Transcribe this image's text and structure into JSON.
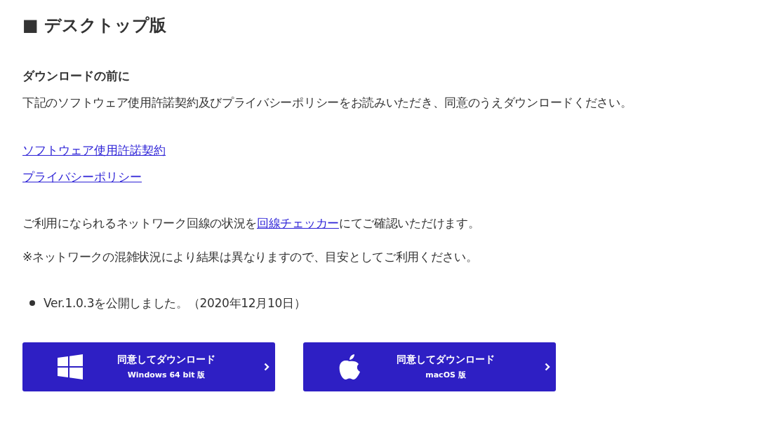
{
  "heading": "■ デスクトップ版",
  "subheading": "ダウンロードの前に",
  "intro": "下記のソフトウェア使用許諾契約及びプライバシーポリシーをお読みいただき、同意のうえダウンロードください。",
  "links": [
    "ソフトウェア使用許諾契約",
    "プライバシーポリシー"
  ],
  "network_note": {
    "before": "ご利用になられるネットワーク回線の状況を",
    "link": "回線チェッカー",
    "after": "にてご確認いただけます。"
  },
  "caution": "※ネットワークの混雑状況により結果は異なりますので、目安としてご利用ください。",
  "news": [
    "Ver.1.0.3を公開しました。（2020年12月10日）"
  ],
  "buttons": [
    {
      "kind": "windows",
      "label": "同意してダウンロード",
      "sublabel": "Windows 64 bit 版"
    },
    {
      "kind": "mac",
      "label": "同意してダウンロード",
      "sublabel": "macOS 版"
    }
  ]
}
